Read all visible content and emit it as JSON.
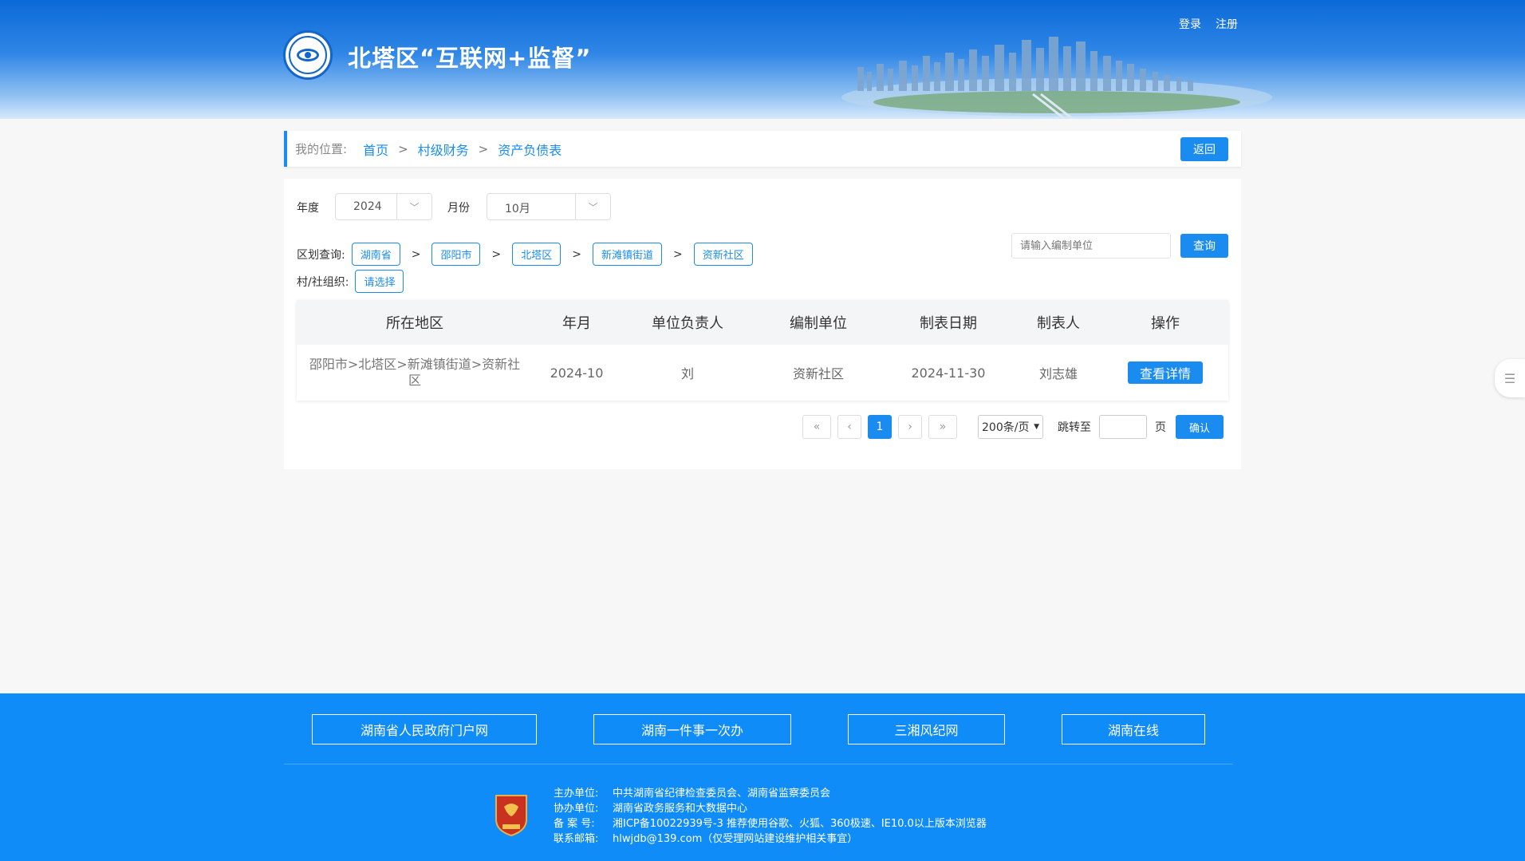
{
  "header": {
    "title": "北塔区“互联网+监督”",
    "login": "登录",
    "register": "注册"
  },
  "breadcrumb": {
    "label": "我的位置:",
    "items": [
      "首页",
      "村级财务",
      "资产负债表"
    ],
    "separator": ">",
    "back": "返回"
  },
  "filters": {
    "year_label": "年度",
    "year_value": "2024",
    "month_label": "月份",
    "month_value": "10月",
    "region_label": "区划查询:",
    "regions": [
      "湖南省",
      "邵阳市",
      "北塔区",
      "新滩镇街道",
      "资新社区"
    ],
    "org_label": "村/社组织:",
    "org_value": "请选择",
    "search_placeholder": "请输入编制单位",
    "search_btn": "查询"
  },
  "table": {
    "headers": [
      "所在地区",
      "年月",
      "单位负责人",
      "编制单位",
      "制表日期",
      "制表人",
      "操作"
    ],
    "rows": [
      {
        "region": "邵阳市>北塔区>新滩镇街道>资新社区",
        "period": "2024-10",
        "leader": "刘",
        "unit": "资新社区",
        "date": "2024-11-30",
        "maker": "刘志雄",
        "action": "查看详情"
      }
    ]
  },
  "pager": {
    "current": "1",
    "page_size": "200条/页",
    "jump_label": "跳转至",
    "page_unit": "页",
    "confirm": "确认"
  },
  "footer": {
    "links": [
      "湖南省人民政府门户网",
      "湖南一件事一次办",
      "三湘风纪网",
      "湖南在线"
    ],
    "info": [
      {
        "k": "主办单位:",
        "v": "中共湖南省纪律检查委员会、湖南省监察委员会"
      },
      {
        "k": "协办单位:",
        "v": "湖南省政务服务和大数据中心"
      },
      {
        "k": "备  案  号:",
        "v": "湘ICP备10022939号-3   推荐使用谷歌、火狐、360极速、IE10.0以上版本浏览器"
      },
      {
        "k": "联系邮箱:",
        "v": "hlwjdb@139.com（仅受理网站建设维护相关事宜）"
      }
    ]
  },
  "colors": {
    "primary": "#1a8cf0",
    "footer": "#0f8cf7",
    "header": "#0b6ad8"
  }
}
